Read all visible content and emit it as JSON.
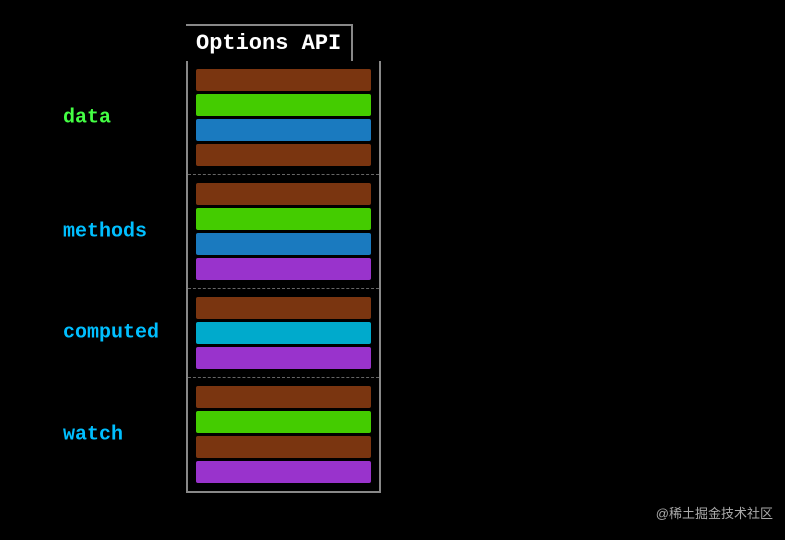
{
  "title": "Options API",
  "sections": [
    {
      "label": "data",
      "bars": [
        "brown",
        "green",
        "blue",
        "brown2"
      ]
    },
    {
      "label": "methods",
      "bars": [
        "brown",
        "green",
        "blue",
        "purple"
      ]
    },
    {
      "label": "computed",
      "bars": [
        "brown",
        "cyan",
        "purple"
      ]
    },
    {
      "label": "watch",
      "bars": [
        "brown",
        "green",
        "brown2",
        "purple"
      ]
    }
  ],
  "watermark": "@稀土掘金技术社区",
  "bar_colors": {
    "brown": "#7a3510",
    "green": "#44cc00",
    "blue": "#1a7abf",
    "brown2": "#7a3510",
    "purple": "#9933cc",
    "cyan": "#00aacc"
  },
  "label_color": "#00bfff",
  "title_color": "#ffffff"
}
